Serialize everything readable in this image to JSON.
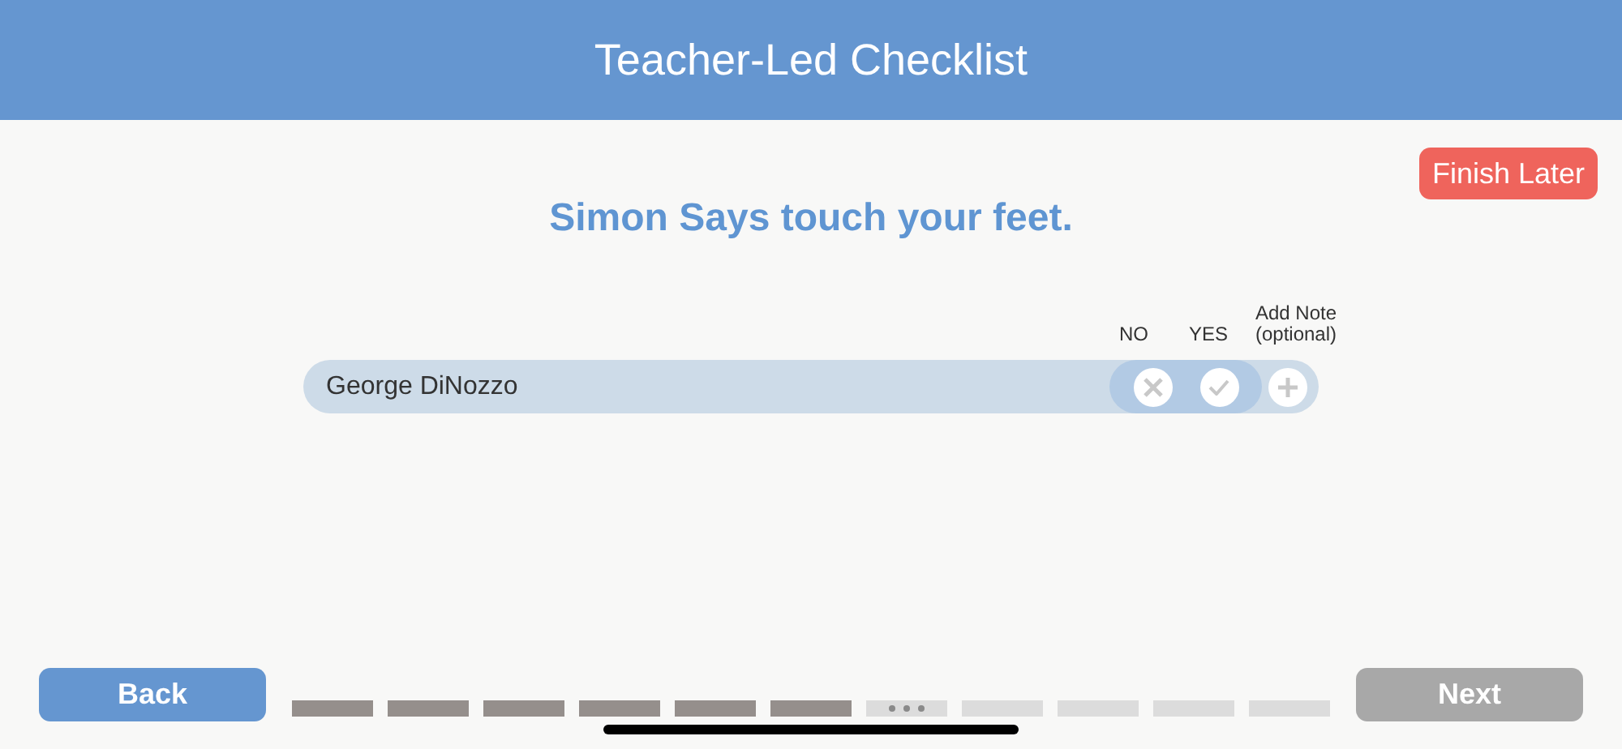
{
  "header": {
    "title": "Teacher-Led Checklist"
  },
  "finish_later": "Finish Later",
  "question": "Simon Says touch your feet.",
  "columns": [
    "NO",
    "YES",
    "Add Note\n(optional)"
  ],
  "students": [
    {
      "name": "George DiNozzo"
    }
  ],
  "footer": {
    "back": "Back",
    "next": "Next",
    "next_disabled": true,
    "progress": [
      {
        "kind": "done"
      },
      {
        "kind": "done"
      },
      {
        "kind": "done"
      },
      {
        "kind": "done"
      },
      {
        "kind": "done"
      },
      {
        "kind": "done"
      },
      {
        "kind": "current"
      },
      {
        "kind": "todo"
      },
      {
        "kind": "todo"
      },
      {
        "kind": "todo"
      },
      {
        "kind": "todo"
      }
    ]
  }
}
